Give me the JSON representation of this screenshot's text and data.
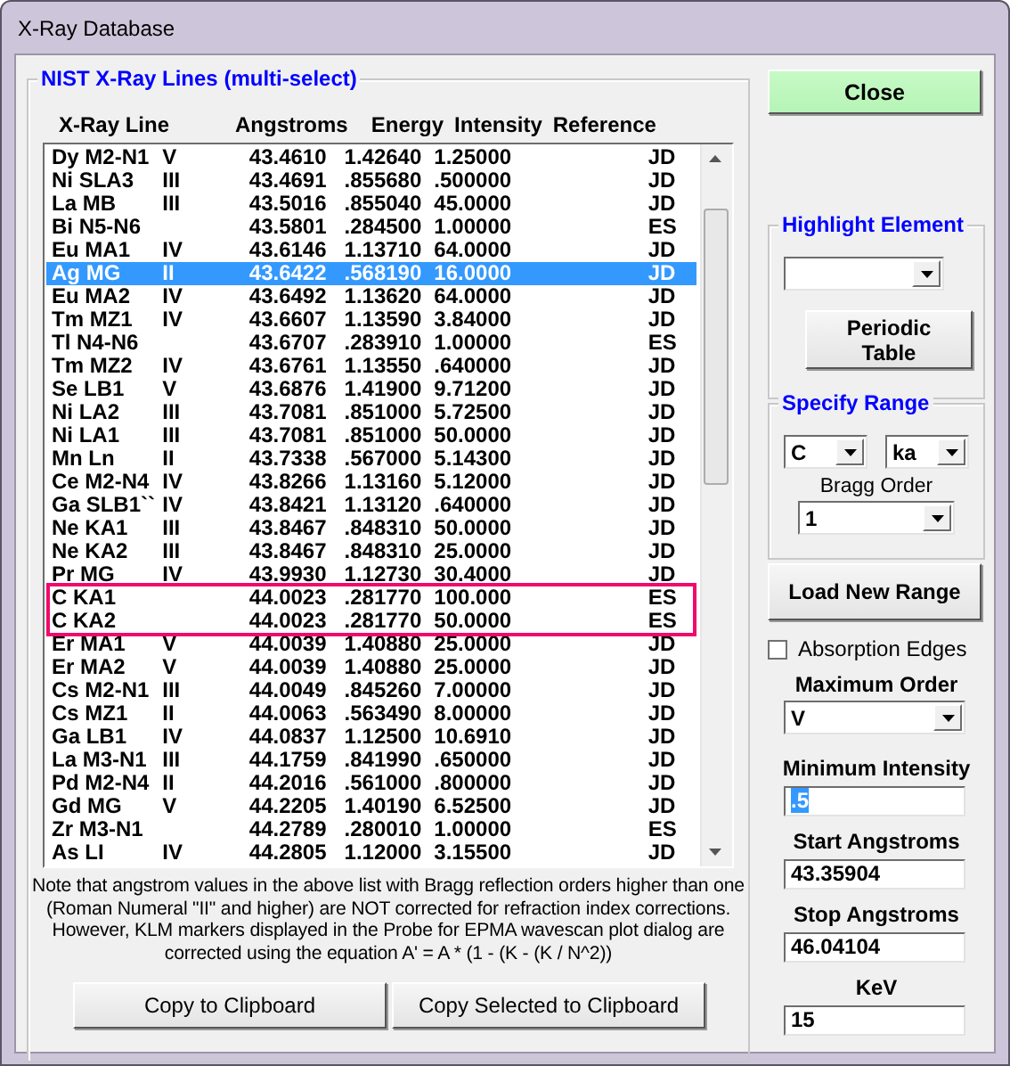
{
  "window": {
    "title": "X-Ray Database"
  },
  "lines_panel": {
    "title": "NIST X-Ray Lines (multi-select)",
    "columns": [
      "X-Ray Line",
      "Angstroms",
      "Energy",
      "Intensity",
      "Reference"
    ],
    "rows": [
      {
        "line": "Dy M2-N1",
        "order": "V",
        "angstroms": "43.4610",
        "energy": "1.42640",
        "intensity": "1.25000",
        "reference": "JD",
        "selected": false,
        "boxed": false
      },
      {
        "line": "Ni SLA3",
        "order": "III",
        "angstroms": "43.4691",
        "energy": ".855680",
        "intensity": ".500000",
        "reference": "JD",
        "selected": false,
        "boxed": false
      },
      {
        "line": "La MB",
        "order": "III",
        "angstroms": "43.5016",
        "energy": ".855040",
        "intensity": "45.0000",
        "reference": "JD",
        "selected": false,
        "boxed": false
      },
      {
        "line": "Bi N5-N6",
        "order": "",
        "angstroms": "43.5801",
        "energy": ".284500",
        "intensity": "1.00000",
        "reference": "ES",
        "selected": false,
        "boxed": false
      },
      {
        "line": "Eu MA1",
        "order": "IV",
        "angstroms": "43.6146",
        "energy": "1.13710",
        "intensity": "64.0000",
        "reference": "JD",
        "selected": false,
        "boxed": false
      },
      {
        "line": "Ag MG",
        "order": "II",
        "angstroms": "43.6422",
        "energy": ".568190",
        "intensity": "16.0000",
        "reference": "JD",
        "selected": true,
        "boxed": false
      },
      {
        "line": "Eu MA2",
        "order": "IV",
        "angstroms": "43.6492",
        "energy": "1.13620",
        "intensity": "64.0000",
        "reference": "JD",
        "selected": false,
        "boxed": false
      },
      {
        "line": "Tm MZ1",
        "order": "IV",
        "angstroms": "43.6607",
        "energy": "1.13590",
        "intensity": "3.84000",
        "reference": "JD",
        "selected": false,
        "boxed": false
      },
      {
        "line": "Tl N4-N6",
        "order": "",
        "angstroms": "43.6707",
        "energy": ".283910",
        "intensity": "1.00000",
        "reference": "ES",
        "selected": false,
        "boxed": false
      },
      {
        "line": "Tm MZ2",
        "order": "IV",
        "angstroms": "43.6761",
        "energy": "1.13550",
        "intensity": ".640000",
        "reference": "JD",
        "selected": false,
        "boxed": false
      },
      {
        "line": "Se LB1",
        "order": "V",
        "angstroms": "43.6876",
        "energy": "1.41900",
        "intensity": "9.71200",
        "reference": "JD",
        "selected": false,
        "boxed": false
      },
      {
        "line": "Ni LA2",
        "order": "III",
        "angstroms": "43.7081",
        "energy": ".851000",
        "intensity": "5.72500",
        "reference": "JD",
        "selected": false,
        "boxed": false
      },
      {
        "line": "Ni LA1",
        "order": "III",
        "angstroms": "43.7081",
        "energy": ".851000",
        "intensity": "50.0000",
        "reference": "JD",
        "selected": false,
        "boxed": false
      },
      {
        "line": "Mn Ln",
        "order": "II",
        "angstroms": "43.7338",
        "energy": ".567000",
        "intensity": "5.14300",
        "reference": "JD",
        "selected": false,
        "boxed": false
      },
      {
        "line": "Ce M2-N4",
        "order": "IV",
        "angstroms": "43.8266",
        "energy": "1.13160",
        "intensity": "5.12000",
        "reference": "JD",
        "selected": false,
        "boxed": false
      },
      {
        "line": "Ga SLB1``",
        "order": "IV",
        "angstroms": "43.8421",
        "energy": "1.13120",
        "intensity": ".640000",
        "reference": "JD",
        "selected": false,
        "boxed": false
      },
      {
        "line": "Ne KA1",
        "order": "III",
        "angstroms": "43.8467",
        "energy": ".848310",
        "intensity": "50.0000",
        "reference": "JD",
        "selected": false,
        "boxed": false
      },
      {
        "line": "Ne KA2",
        "order": "III",
        "angstroms": "43.8467",
        "energy": ".848310",
        "intensity": "25.0000",
        "reference": "JD",
        "selected": false,
        "boxed": false
      },
      {
        "line": "Pr MG",
        "order": "IV",
        "angstroms": "43.9930",
        "energy": "1.12730",
        "intensity": "30.4000",
        "reference": "JD",
        "selected": false,
        "boxed": false
      },
      {
        "line": "C  KA1",
        "order": "",
        "angstroms": "44.0023",
        "energy": ".281770",
        "intensity": "100.000",
        "reference": "ES",
        "selected": false,
        "boxed": true
      },
      {
        "line": "C  KA2",
        "order": "",
        "angstroms": "44.0023",
        "energy": ".281770",
        "intensity": "50.0000",
        "reference": "ES",
        "selected": false,
        "boxed": true
      },
      {
        "line": "Er MA1",
        "order": "V",
        "angstroms": "44.0039",
        "energy": "1.40880",
        "intensity": "25.0000",
        "reference": "JD",
        "selected": false,
        "boxed": false
      },
      {
        "line": "Er MA2",
        "order": "V",
        "angstroms": "44.0039",
        "energy": "1.40880",
        "intensity": "25.0000",
        "reference": "JD",
        "selected": false,
        "boxed": false
      },
      {
        "line": "Cs M2-N1",
        "order": "III",
        "angstroms": "44.0049",
        "energy": ".845260",
        "intensity": "7.00000",
        "reference": "JD",
        "selected": false,
        "boxed": false
      },
      {
        "line": "Cs MZ1",
        "order": "II",
        "angstroms": "44.0063",
        "energy": ".563490",
        "intensity": "8.00000",
        "reference": "JD",
        "selected": false,
        "boxed": false
      },
      {
        "line": "Ga LB1",
        "order": "IV",
        "angstroms": "44.0837",
        "energy": "1.12500",
        "intensity": "10.6910",
        "reference": "JD",
        "selected": false,
        "boxed": false
      },
      {
        "line": "La M3-N1",
        "order": "III",
        "angstroms": "44.1759",
        "energy": ".841990",
        "intensity": ".650000",
        "reference": "JD",
        "selected": false,
        "boxed": false
      },
      {
        "line": "Pd M2-N4",
        "order": "II",
        "angstroms": "44.2016",
        "energy": ".561000",
        "intensity": ".800000",
        "reference": "JD",
        "selected": false,
        "boxed": false
      },
      {
        "line": "Gd MG",
        "order": "V",
        "angstroms": "44.2205",
        "energy": "1.40190",
        "intensity": "6.52500",
        "reference": "JD",
        "selected": false,
        "boxed": false
      },
      {
        "line": "Zr M3-N1",
        "order": "",
        "angstroms": "44.2789",
        "energy": ".280010",
        "intensity": "1.00000",
        "reference": "ES",
        "selected": false,
        "boxed": false
      },
      {
        "line": "As LI",
        "order": "IV",
        "angstroms": "44.2805",
        "energy": "1.12000",
        "intensity": "3.15500",
        "reference": "JD",
        "selected": false,
        "boxed": false
      }
    ],
    "note": "Note that angstrom values in the above list with Bragg reflection orders higher than one (Roman Numeral \"II\" and higher) are NOT corrected for refraction index corrections. However, KLM markers displayed in the Probe for EPMA wavescan plot dialog are corrected using the equation A' = A * (1 - (K - (K / N^2))",
    "buttons": [
      "Copy to Clipboard",
      "Copy Selected to Clipboard"
    ]
  },
  "close_button": "Close",
  "highlight_element": {
    "title": "Highlight Element",
    "button": "Periodic Table"
  },
  "specify_range": {
    "title": "Specify Range",
    "element": "C",
    "line": "ka",
    "bragg_order_label": "Bragg Order",
    "bragg_order": "1"
  },
  "load_button": "Load New Range",
  "absorption_edges": {
    "label": "Absorption Edges",
    "checked": false
  },
  "maximum_order": {
    "label": "Maximum Order",
    "value": "V"
  },
  "fields": [
    {
      "label": "Minimum Intensity",
      "value": ".5",
      "text_selected": true
    },
    {
      "label": "Start Angstroms",
      "value": "43.35904",
      "text_selected": false
    },
    {
      "label": "Stop Angstroms",
      "value": "46.04104",
      "text_selected": false
    },
    {
      "label": "KeV",
      "value": "15",
      "text_selected": false
    }
  ]
}
